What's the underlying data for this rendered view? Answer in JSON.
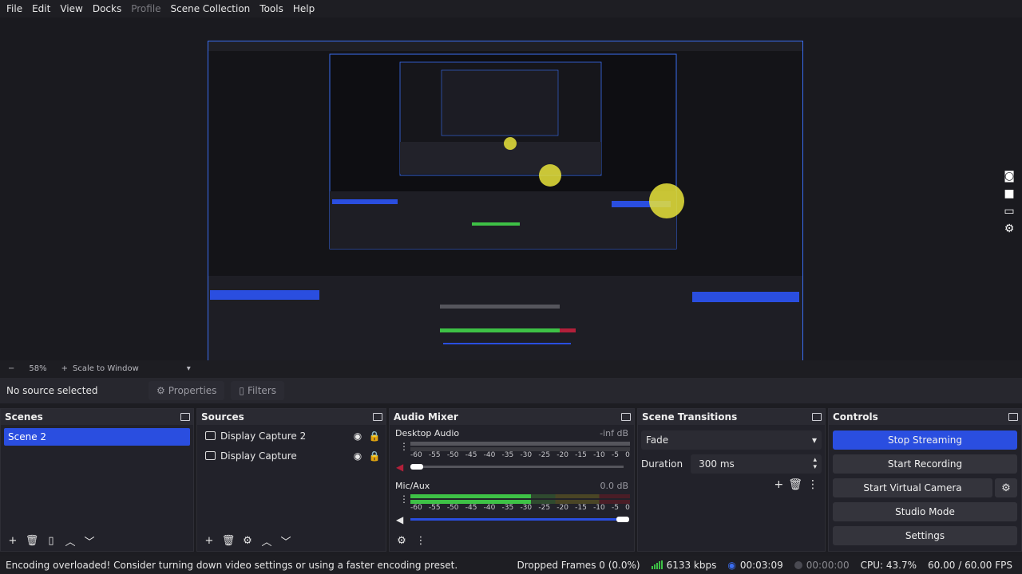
{
  "menu": [
    "File",
    "Edit",
    "View",
    "Docks",
    "Profile",
    "Scene Collection",
    "Tools",
    "Help"
  ],
  "menu_disabled": "Profile",
  "zoom": {
    "minus": "−",
    "level": "58%",
    "plus": "+",
    "mode": "Scale to Window"
  },
  "context": {
    "no_source": "No source selected",
    "properties": "Properties",
    "filters": "Filters"
  },
  "scenes": {
    "title": "Scenes",
    "items": [
      "Scene 2"
    ]
  },
  "sources": {
    "title": "Sources",
    "items": [
      "Display Capture 2",
      "Display Capture"
    ]
  },
  "mixer": {
    "title": "Audio Mixer",
    "channels": [
      {
        "name": "Desktop Audio",
        "db": "-inf dB",
        "level": 0.0,
        "muted": true
      },
      {
        "name": "Mic/Aux",
        "db": "0.0 dB",
        "level": 0.55,
        "muted": false
      }
    ],
    "scale": [
      "-60",
      "-55",
      "-50",
      "-45",
      "-40",
      "-35",
      "-30",
      "-25",
      "-20",
      "-15",
      "-10",
      "-5",
      "0"
    ]
  },
  "transitions": {
    "title": "Scene Transitions",
    "selected": "Fade",
    "duration_label": "Duration",
    "duration_value": "300 ms"
  },
  "controls": {
    "title": "Controls",
    "stop_streaming": "Stop Streaming",
    "start_recording": "Start Recording",
    "start_virtual_camera": "Start Virtual Camera",
    "studio_mode": "Studio Mode",
    "settings": "Settings"
  },
  "status": {
    "message": "Encoding overloaded! Consider turning down video settings or using a faster encoding preset.",
    "dropped": "Dropped Frames 0 (0.0%)",
    "bitrate": "6133 kbps",
    "stream_time": "00:03:09",
    "record_time": "00:00:00",
    "cpu": "CPU: 43.7%",
    "fps": "60.00 / 60.00 FPS"
  },
  "colors": {
    "accent": "#2a4ee0",
    "meter_green": "#3ec146",
    "meter_yellow": "#b6a531",
    "meter_red": "#b3203a"
  }
}
